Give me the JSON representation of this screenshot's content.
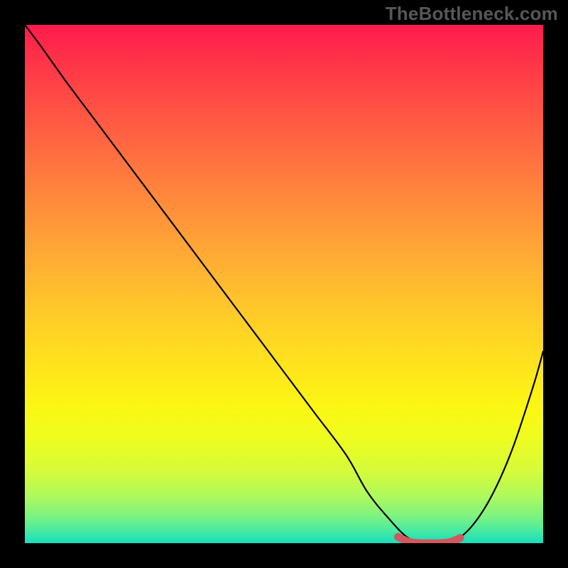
{
  "watermark": "TheBottleneck.com",
  "colors": {
    "frame": "#000000",
    "watermark_text": "#575757",
    "curve": "#000000",
    "highlight": "#d1585e"
  },
  "chart_data": {
    "type": "line",
    "title": "",
    "xlabel": "",
    "ylabel": "",
    "xlim": [
      0,
      100
    ],
    "ylim": [
      0,
      100
    ],
    "grid": false,
    "legend": false,
    "series": [
      {
        "name": "bottleneck-curve",
        "x": [
          0,
          3,
          8,
          14,
          20,
          26,
          32,
          38,
          44,
          50,
          56,
          62,
          66,
          70,
          74,
          78,
          82,
          86,
          90,
          94,
          98,
          100
        ],
        "y": [
          100,
          96,
          89,
          81,
          73,
          65,
          57,
          49,
          41,
          33,
          25,
          17,
          10,
          5,
          1,
          0,
          0,
          3,
          9,
          18,
          30,
          37
        ]
      },
      {
        "name": "optimal-range-highlight",
        "x": [
          72,
          74,
          76,
          78,
          80,
          82,
          84
        ],
        "y": [
          1.2,
          0.3,
          0,
          0,
          0,
          0.2,
          1.0
        ]
      }
    ],
    "annotations": []
  }
}
